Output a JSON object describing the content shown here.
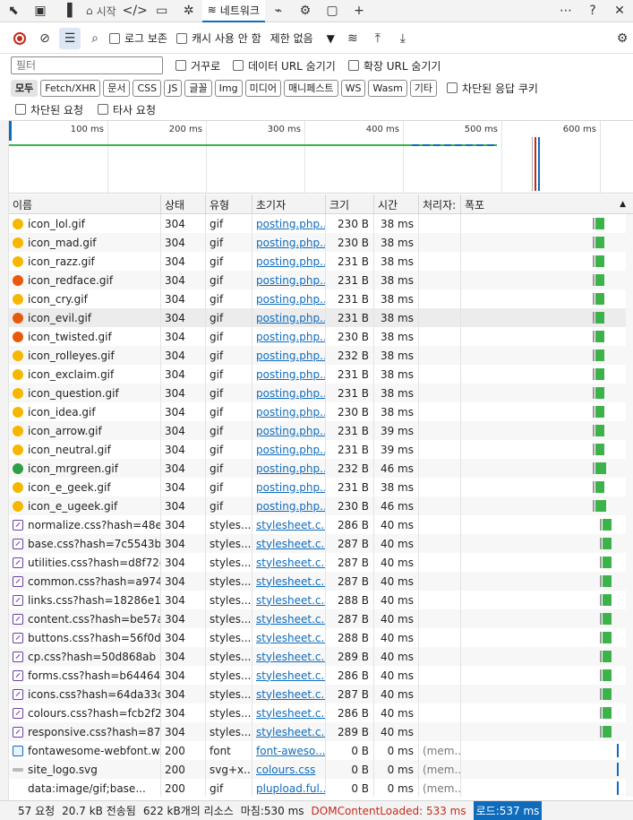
{
  "tabs": {
    "welcome": "시작",
    "network": "네트워크"
  },
  "toolbar": {
    "preserve_log": "로그 보존",
    "disable_cache": "캐시 사용 안 함",
    "throttling": "제한 없음"
  },
  "filter": {
    "placeholder": "필터",
    "invert": "거꾸로",
    "hide_data_urls": "데이터 URL 숨기기",
    "hide_extension_urls": "확장 URL 숨기기"
  },
  "type_filters": [
    "모두",
    "Fetch/XHR",
    "문서",
    "CSS",
    "JS",
    "글꼴",
    "Img",
    "미디어",
    "매니페스트",
    "WS",
    "Wasm",
    "기타"
  ],
  "blocked_cookies": "차단된 응답 쿠키",
  "blocked_requests": "차단된 요청",
  "third_party": "타사 요청",
  "overview_ticks": [
    "100 ms",
    "200 ms",
    "300 ms",
    "400 ms",
    "500 ms",
    "600 ms"
  ],
  "columns": [
    "이름",
    "상태",
    "유형",
    "초기자",
    "크기",
    "시간",
    "처리자:",
    "폭포"
  ],
  "rows": [
    {
      "name": "icon_lol.gif",
      "status": "304",
      "type": "gif",
      "initiator": "posting.php...",
      "size": "230 B",
      "time": "38 ms",
      "handler": "",
      "icon": "gif-emoticon-icon"
    },
    {
      "name": "icon_mad.gif",
      "status": "304",
      "type": "gif",
      "initiator": "posting.php...",
      "size": "230 B",
      "time": "38 ms",
      "handler": "",
      "icon": "gif-emoticon-icon"
    },
    {
      "name": "icon_razz.gif",
      "status": "304",
      "type": "gif",
      "initiator": "posting.php...",
      "size": "231 B",
      "time": "38 ms",
      "handler": "",
      "icon": "gif-emoticon-icon"
    },
    {
      "name": "icon_redface.gif",
      "status": "304",
      "type": "gif",
      "initiator": "posting.php...",
      "size": "231 B",
      "time": "38 ms",
      "handler": "",
      "icon": "gif-emoticon-icon"
    },
    {
      "name": "icon_cry.gif",
      "status": "304",
      "type": "gif",
      "initiator": "posting.php...",
      "size": "231 B",
      "time": "38 ms",
      "handler": "",
      "icon": "gif-emoticon-icon"
    },
    {
      "name": "icon_evil.gif",
      "status": "304",
      "type": "gif",
      "initiator": "posting.php...",
      "size": "231 B",
      "time": "38 ms",
      "handler": "",
      "icon": "gif-emoticon-icon"
    },
    {
      "name": "icon_twisted.gif",
      "status": "304",
      "type": "gif",
      "initiator": "posting.php...",
      "size": "230 B",
      "time": "38 ms",
      "handler": "",
      "icon": "gif-emoticon-icon"
    },
    {
      "name": "icon_rolleyes.gif",
      "status": "304",
      "type": "gif",
      "initiator": "posting.php...",
      "size": "232 B",
      "time": "38 ms",
      "handler": "",
      "icon": "gif-emoticon-icon"
    },
    {
      "name": "icon_exclaim.gif",
      "status": "304",
      "type": "gif",
      "initiator": "posting.php...",
      "size": "231 B",
      "time": "38 ms",
      "handler": "",
      "icon": "gif-emoticon-icon"
    },
    {
      "name": "icon_question.gif",
      "status": "304",
      "type": "gif",
      "initiator": "posting.php...",
      "size": "231 B",
      "time": "38 ms",
      "handler": "",
      "icon": "gif-emoticon-icon"
    },
    {
      "name": "icon_idea.gif",
      "status": "304",
      "type": "gif",
      "initiator": "posting.php...",
      "size": "230 B",
      "time": "38 ms",
      "handler": "",
      "icon": "gif-emoticon-icon"
    },
    {
      "name": "icon_arrow.gif",
      "status": "304",
      "type": "gif",
      "initiator": "posting.php...",
      "size": "231 B",
      "time": "39 ms",
      "handler": "",
      "icon": "gif-emoticon-icon"
    },
    {
      "name": "icon_neutral.gif",
      "status": "304",
      "type": "gif",
      "initiator": "posting.php...",
      "size": "231 B",
      "time": "39 ms",
      "handler": "",
      "icon": "gif-emoticon-icon"
    },
    {
      "name": "icon_mrgreen.gif",
      "status": "304",
      "type": "gif",
      "initiator": "posting.php...",
      "size": "232 B",
      "time": "46 ms",
      "handler": "",
      "icon": "gif-emoticon-green-icon"
    },
    {
      "name": "icon_e_geek.gif",
      "status": "304",
      "type": "gif",
      "initiator": "posting.php...",
      "size": "231 B",
      "time": "38 ms",
      "handler": "",
      "icon": "gif-emoticon-icon"
    },
    {
      "name": "icon_e_ugeek.gif",
      "status": "304",
      "type": "gif",
      "initiator": "posting.php...",
      "size": "230 B",
      "time": "46 ms",
      "handler": "",
      "icon": "gif-emoticon-icon"
    },
    {
      "name": "normalize.css?hash=48e...",
      "status": "304",
      "type": "styles...",
      "initiator": "stylesheet.c...",
      "size": "286 B",
      "time": "40 ms",
      "handler": "",
      "icon": "css-file-icon"
    },
    {
      "name": "base.css?hash=7c5543be",
      "status": "304",
      "type": "styles...",
      "initiator": "stylesheet.c...",
      "size": "287 B",
      "time": "40 ms",
      "handler": "",
      "icon": "css-file-icon"
    },
    {
      "name": "utilities.css?hash=d8f72c...",
      "status": "304",
      "type": "styles...",
      "initiator": "stylesheet.c...",
      "size": "287 B",
      "time": "40 ms",
      "handler": "",
      "icon": "css-file-icon"
    },
    {
      "name": "common.css?hash=a974...",
      "status": "304",
      "type": "styles...",
      "initiator": "stylesheet.c...",
      "size": "287 B",
      "time": "40 ms",
      "handler": "",
      "icon": "css-file-icon"
    },
    {
      "name": "links.css?hash=18286e16",
      "status": "304",
      "type": "styles...",
      "initiator": "stylesheet.c...",
      "size": "288 B",
      "time": "40 ms",
      "handler": "",
      "icon": "css-file-icon"
    },
    {
      "name": "content.css?hash=be57a...",
      "status": "304",
      "type": "styles...",
      "initiator": "stylesheet.c...",
      "size": "287 B",
      "time": "40 ms",
      "handler": "",
      "icon": "css-file-icon"
    },
    {
      "name": "buttons.css?hash=56f0d...",
      "status": "304",
      "type": "styles...",
      "initiator": "stylesheet.c...",
      "size": "288 B",
      "time": "40 ms",
      "handler": "",
      "icon": "css-file-icon"
    },
    {
      "name": "cp.css?hash=50d868ab",
      "status": "304",
      "type": "styles...",
      "initiator": "stylesheet.c...",
      "size": "289 B",
      "time": "40 ms",
      "handler": "",
      "icon": "css-file-icon"
    },
    {
      "name": "forms.css?hash=b64464fb",
      "status": "304",
      "type": "styles...",
      "initiator": "stylesheet.c...",
      "size": "286 B",
      "time": "40 ms",
      "handler": "",
      "icon": "css-file-icon"
    },
    {
      "name": "icons.css?hash=64da33ce",
      "status": "304",
      "type": "styles...",
      "initiator": "stylesheet.c...",
      "size": "287 B",
      "time": "40 ms",
      "handler": "",
      "icon": "css-file-icon"
    },
    {
      "name": "colours.css?hash=fcb2f2...",
      "status": "304",
      "type": "styles...",
      "initiator": "stylesheet.c...",
      "size": "286 B",
      "time": "40 ms",
      "handler": "",
      "icon": "css-file-icon"
    },
    {
      "name": "responsive.css?hash=87...",
      "status": "304",
      "type": "styles...",
      "initiator": "stylesheet.c...",
      "size": "289 B",
      "time": "40 ms",
      "handler": "",
      "icon": "css-file-icon"
    },
    {
      "name": "fontawesome-webfont.w...",
      "status": "200",
      "type": "font",
      "initiator": "font-aweso...",
      "size": "0 B",
      "time": "0 ms",
      "handler": "(mem...",
      "icon": "font-file-icon"
    },
    {
      "name": "site_logo.svg",
      "status": "200",
      "type": "svg+x...",
      "initiator": "colours.css",
      "size": "0 B",
      "time": "0 ms",
      "handler": "(mem...",
      "icon": "svg-file-icon"
    },
    {
      "name": "data:image/gif;base...",
      "status": "200",
      "type": "gif",
      "initiator": "plupload.ful...",
      "size": "0 B",
      "time": "0 ms",
      "handler": "(mem...",
      "icon": "data-uri-icon"
    }
  ],
  "statusbar": {
    "requests": "57 요청",
    "transferred": "20.7 kB 전송됨",
    "resources": "622 kB개의 리소스",
    "finish": "마침:530 ms",
    "dcl": "DOMContentLoaded: 533 ms",
    "load": "로드:537 ms"
  },
  "colors": {
    "accent": "#0f6cbd",
    "record": "#c42b1c",
    "waterfall_receive": "#3cb34a",
    "dcl": "#c42b1c"
  }
}
